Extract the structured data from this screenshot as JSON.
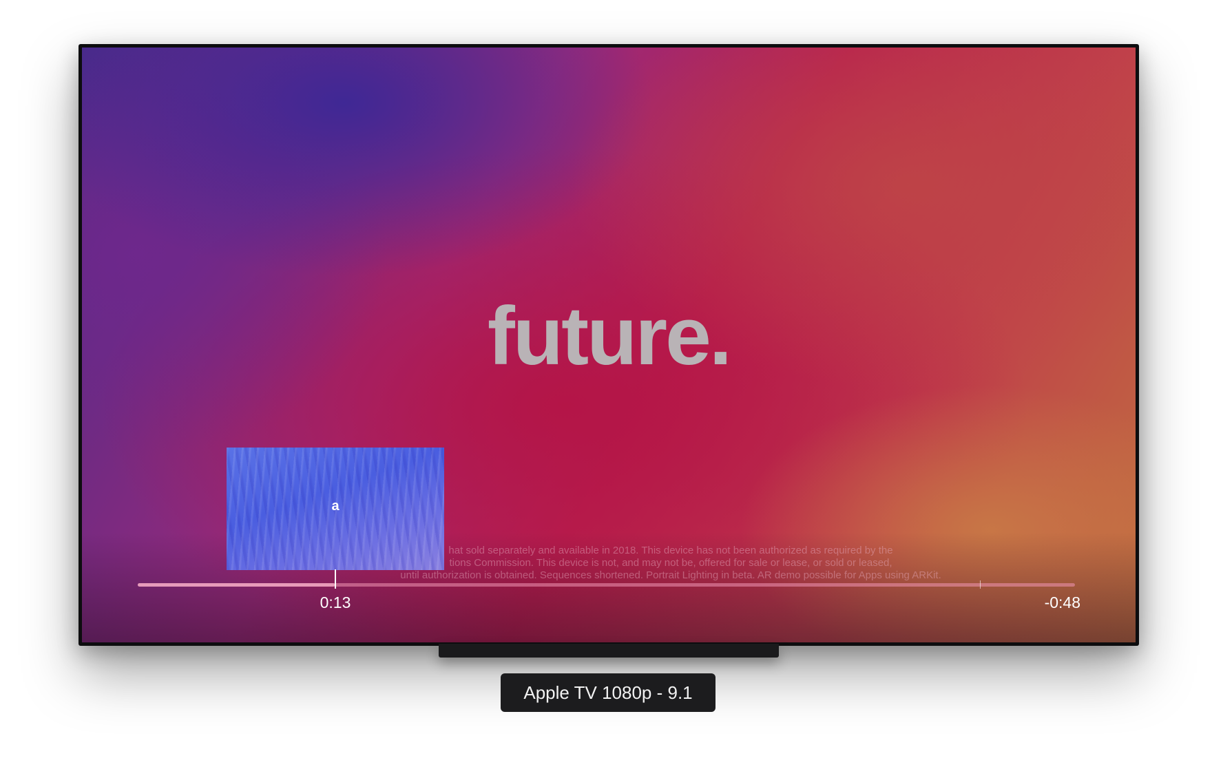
{
  "video": {
    "headline": "future.",
    "disclaimer_lines": [
      "hat sold separately and available in 2018. This device has not been authorized as required by the",
      "tions Commission. This device is not, and may not be, offered for sale or lease, or sold or leased,",
      "until authorization is obtained. Sequences shortened. Portrait Lighting in beta. AR demo possible for Apps using ARKit."
    ]
  },
  "player": {
    "elapsed": "0:13",
    "remaining": "-0:48",
    "progress": 0.21,
    "thumbnail_label": "a"
  },
  "simulator": {
    "device_label": "Apple TV 1080p - 9.1"
  },
  "colors": {
    "headline": "#b9b3b6",
    "label_bg": "#1c1c1e"
  }
}
